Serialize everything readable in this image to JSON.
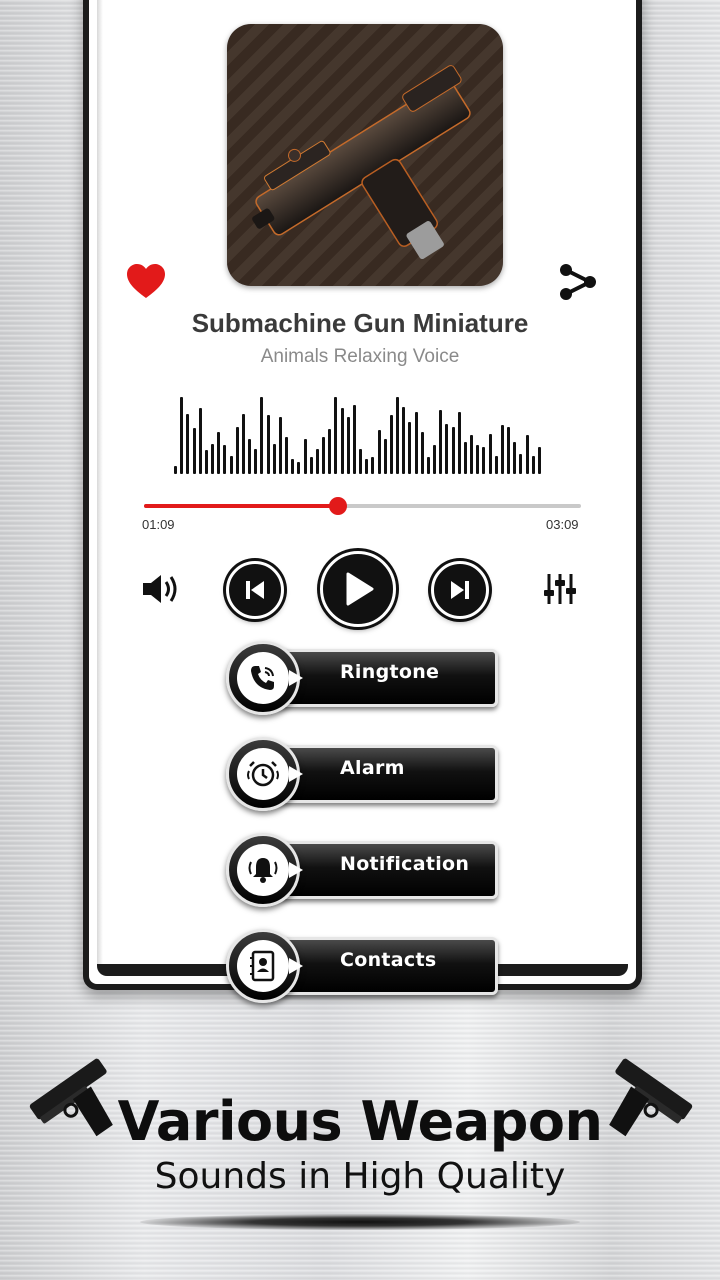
{
  "track": {
    "title": "Submachine Gun Miniature",
    "subtitle": "Animals Relaxing Voice"
  },
  "player": {
    "elapsed": "01:09",
    "duration": "03:09",
    "progress_fraction": 0.445
  },
  "waveform": [
    0.1,
    0.92,
    0.72,
    0.55,
    0.78,
    0.28,
    0.36,
    0.5,
    0.34,
    0.22,
    0.56,
    0.72,
    0.42,
    0.3,
    0.92,
    0.7,
    0.36,
    0.68,
    0.44,
    0.18,
    0.14,
    0.42,
    0.2,
    0.3,
    0.44,
    0.54,
    0.92,
    0.78,
    0.68,
    0.82,
    0.3,
    0.18,
    0.2,
    0.52,
    0.42,
    0.7,
    0.92,
    0.8,
    0.62,
    0.74,
    0.5,
    0.2,
    0.34,
    0.76,
    0.6,
    0.56,
    0.74,
    0.38,
    0.46,
    0.34,
    0.32,
    0.48,
    0.22,
    0.58,
    0.56,
    0.38,
    0.24,
    0.46,
    0.22,
    0.32
  ],
  "actions": [
    {
      "label": "Ringtone",
      "icon": "phone-ring-icon"
    },
    {
      "label": "Alarm",
      "icon": "alarm-clock-icon"
    },
    {
      "label": "Notification",
      "icon": "bell-ring-icon"
    },
    {
      "label": "Contacts",
      "icon": "contact-book-icon"
    }
  ],
  "promo": {
    "headline": "Various Weapon",
    "subhead": "Sounds in High Quality"
  },
  "colors": {
    "accent": "#e21a1a",
    "button": "#111111"
  }
}
